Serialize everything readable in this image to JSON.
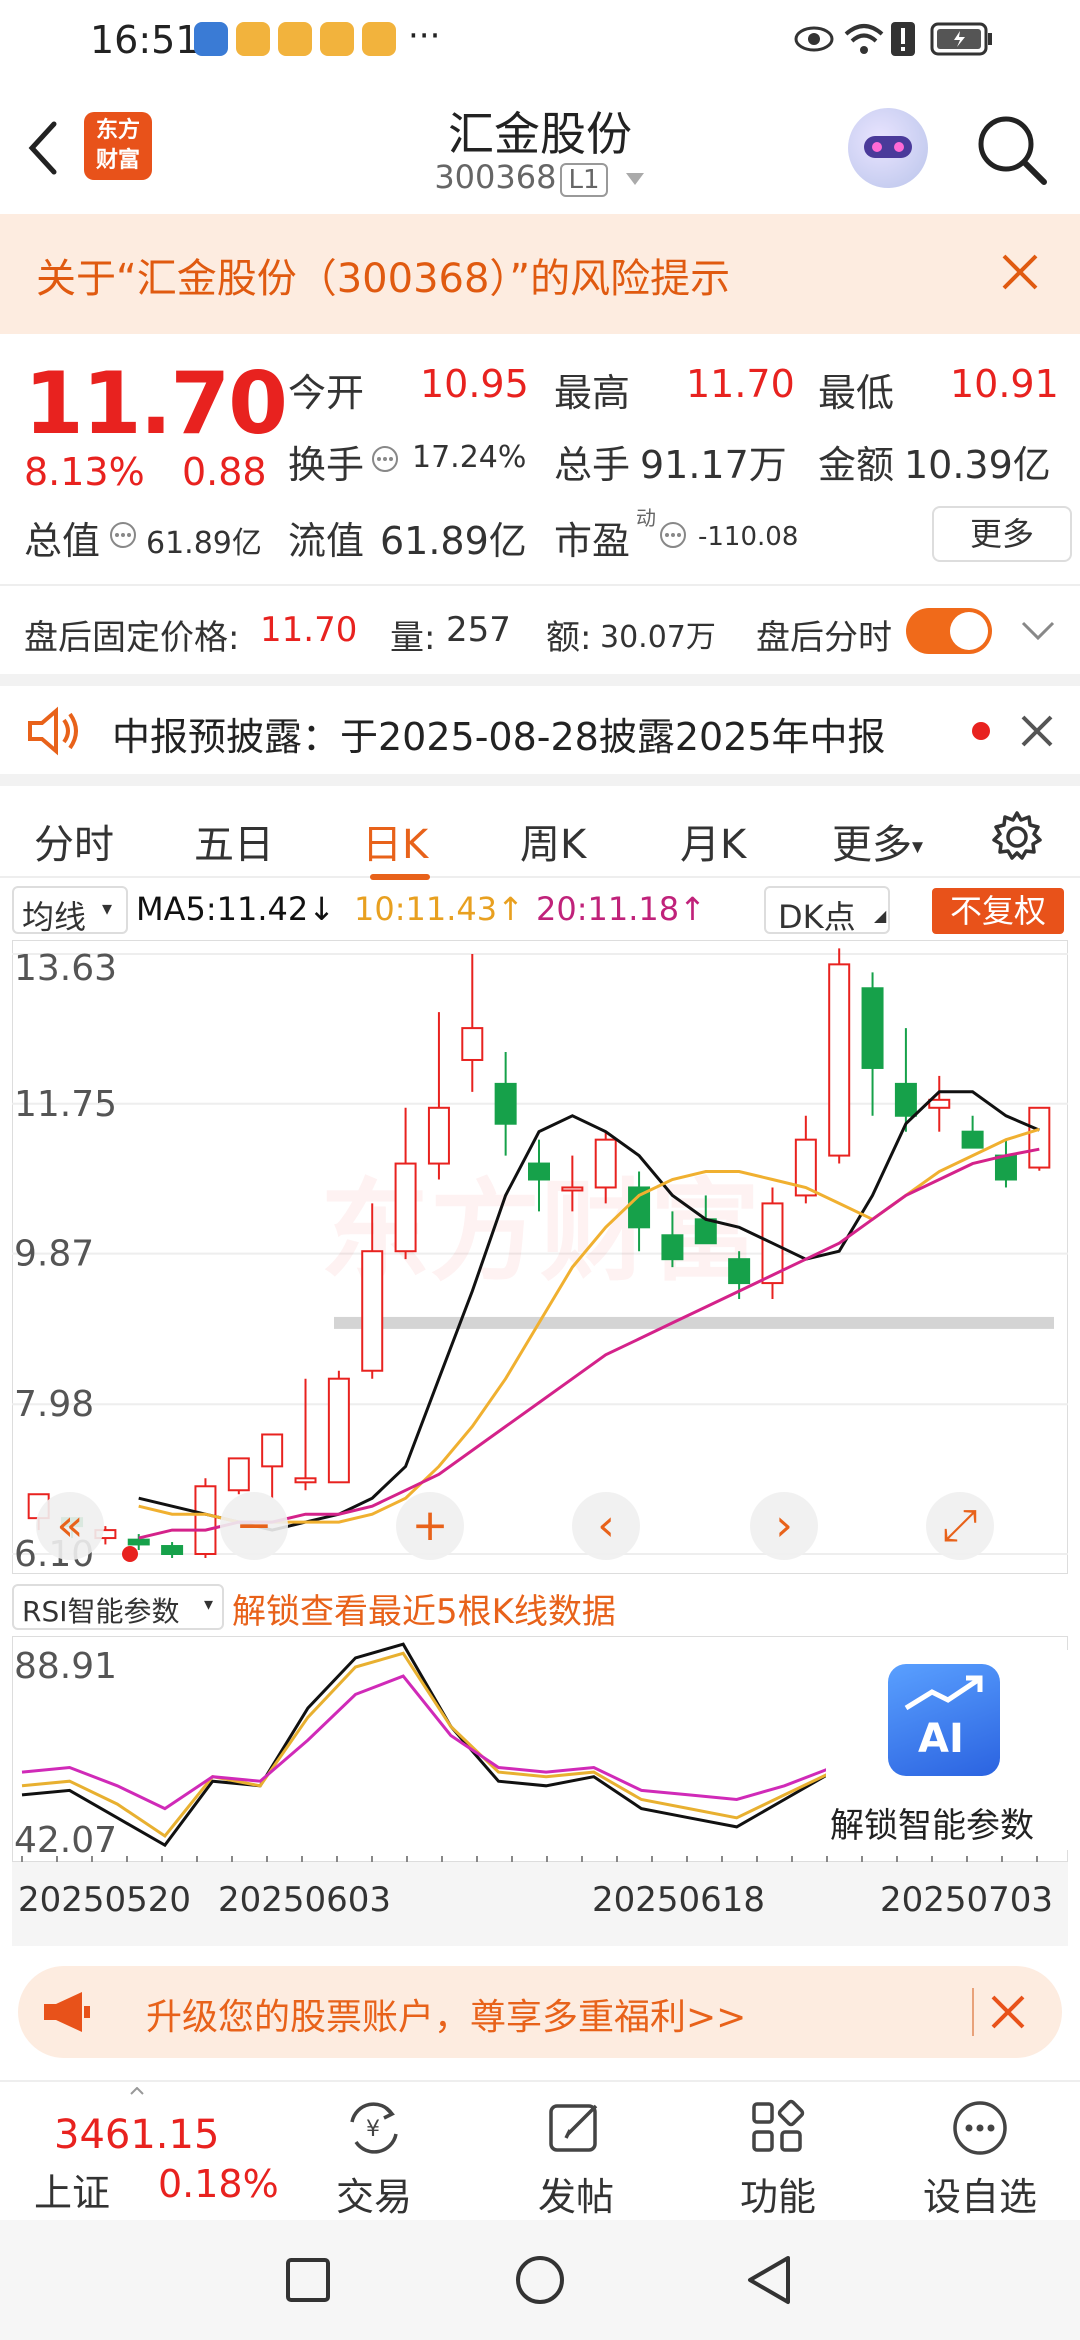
{
  "status_bar": {
    "time": "16:51",
    "dots": "···"
  },
  "header": {
    "title": "汇金股份",
    "code": "300368",
    "level": "L1",
    "logo_line1": "东方",
    "logo_line2": "财富"
  },
  "risk_banner": {
    "text": "关于“汇金股份（300368）”的风险提示"
  },
  "quote": {
    "price": "11.70",
    "change_pct": "8.13%",
    "change": "0.88",
    "open_label": "今开",
    "open": "10.95",
    "high_label": "最高",
    "high": "11.70",
    "low_label": "最低",
    "low": "10.91",
    "turnover_label": "换手",
    "turnover": "17.24%",
    "volume_label": "总手",
    "volume": "91.17万",
    "amount_label": "金额",
    "amount": "10.39亿",
    "mktcap_label": "总值",
    "mktcap": "61.89亿",
    "float_label": "流值",
    "float_cap": "61.89亿",
    "pe_label": "市盈",
    "pe_sup": "动",
    "pe": "-110.08",
    "more": "更多"
  },
  "after_hours": {
    "price_label": "盘后固定价格:",
    "price": "11.70",
    "vol_label": "量:",
    "vol": "257",
    "amt_label": "额:",
    "amt": "30.07万",
    "intraday_label": "盘后分时"
  },
  "notice": {
    "text": "中报预披露：于2025-08-28披露2025年中报"
  },
  "tabs": [
    "分时",
    "五日",
    "日K",
    "周K",
    "月K",
    "更多"
  ],
  "active_tab": 2,
  "ma_row": {
    "selector": "均线",
    "ma5": "MA5:11.42↓",
    "ma10": "10:11.43↑",
    "ma20": "20:11.18↑",
    "dk": "DK点",
    "adjust": "不复权"
  },
  "colors": {
    "up": "#e8221f",
    "down": "#16a14a",
    "accent": "#e8621a",
    "ma5": "#111111",
    "ma10": "#f0b030",
    "ma20": "#d4228a"
  },
  "chart_data": [
    {
      "type": "candlestick",
      "y_ticks": [
        "13.63",
        "11.75",
        "9.87",
        "7.98",
        "6.10"
      ],
      "ylim": [
        6.1,
        13.63
      ],
      "series": [
        {
          "name": "MA5",
          "values": [
            6.8,
            6.7,
            6.6,
            6.5,
            6.4,
            6.5,
            6.6,
            6.8,
            7.2,
            8.3,
            9.4,
            10.6,
            11.4,
            11.6,
            11.4,
            11.1,
            10.6,
            10.3,
            10.2,
            10.0,
            9.8,
            9.9,
            10.6,
            11.5,
            11.9,
            11.9,
            11.6,
            11.42
          ]
        },
        {
          "name": "10",
          "values": [
            6.7,
            6.6,
            6.6,
            6.5,
            6.5,
            6.5,
            6.5,
            6.6,
            6.8,
            7.2,
            7.7,
            8.3,
            9.0,
            9.7,
            10.2,
            10.6,
            10.8,
            10.9,
            10.9,
            10.8,
            10.7,
            10.5,
            10.3,
            10.6,
            10.9,
            11.1,
            11.3,
            11.43
          ]
        },
        {
          "name": "20",
          "values": [
            6.3,
            6.4,
            6.4,
            6.5,
            6.5,
            6.6,
            6.6,
            6.7,
            6.9,
            7.1,
            7.4,
            7.7,
            8.0,
            8.3,
            8.6,
            8.8,
            9.0,
            9.2,
            9.4,
            9.6,
            9.8,
            10.0,
            10.3,
            10.6,
            10.8,
            11.0,
            11.1,
            11.18
          ]
        }
      ],
      "candles": [
        {
          "o": 6.55,
          "h": 6.85,
          "l": 6.4,
          "c": 6.85
        },
        {
          "o": 6.55,
          "h": 6.55,
          "l": 6.3,
          "c": 6.45
        },
        {
          "o": 6.3,
          "h": 6.45,
          "l": 6.22,
          "c": 6.4
        },
        {
          "o": 6.28,
          "h": 6.35,
          "l": 6.15,
          "c": 6.22
        },
        {
          "o": 6.2,
          "h": 6.25,
          "l": 6.05,
          "c": 6.1
        },
        {
          "o": 6.1,
          "h": 7.05,
          "l": 6.05,
          "c": 6.95
        },
        {
          "o": 6.9,
          "h": 7.3,
          "l": 6.85,
          "c": 7.3
        },
        {
          "o": 7.2,
          "h": 7.6,
          "l": 6.8,
          "c": 7.6
        },
        {
          "o": 7.0,
          "h": 8.3,
          "l": 6.9,
          "c": 7.05
        },
        {
          "o": 7.0,
          "h": 8.4,
          "l": 7.0,
          "c": 8.3
        },
        {
          "o": 8.4,
          "h": 10.5,
          "l": 8.3,
          "c": 9.9
        },
        {
          "o": 9.9,
          "h": 11.7,
          "l": 9.8,
          "c": 11.0
        },
        {
          "o": 11.0,
          "h": 12.9,
          "l": 10.8,
          "c": 11.7
        },
        {
          "o": 12.3,
          "h": 13.63,
          "l": 11.9,
          "c": 12.7
        },
        {
          "o": 12.0,
          "h": 12.4,
          "l": 11.1,
          "c": 11.5
        },
        {
          "o": 11.0,
          "h": 11.3,
          "l": 10.4,
          "c": 10.8
        },
        {
          "o": 10.7,
          "h": 11.1,
          "l": 10.4,
          "c": 10.7
        },
        {
          "o": 10.7,
          "h": 11.4,
          "l": 10.5,
          "c": 11.3
        },
        {
          "o": 10.7,
          "h": 10.9,
          "l": 9.9,
          "c": 10.2
        },
        {
          "o": 10.1,
          "h": 10.4,
          "l": 9.7,
          "c": 9.8
        },
        {
          "o": 10.3,
          "h": 10.6,
          "l": 10.1,
          "c": 10.0
        },
        {
          "o": 9.8,
          "h": 9.9,
          "l": 9.3,
          "c": 9.5
        },
        {
          "o": 9.5,
          "h": 10.7,
          "l": 9.3,
          "c": 10.5
        },
        {
          "o": 10.6,
          "h": 11.6,
          "l": 10.5,
          "c": 11.3
        },
        {
          "o": 11.1,
          "h": 13.7,
          "l": 11.0,
          "c": 13.5
        },
        {
          "o": 13.2,
          "h": 13.4,
          "l": 11.6,
          "c": 12.2
        },
        {
          "o": 12.0,
          "h": 12.7,
          "l": 11.4,
          "c": 11.6
        },
        {
          "o": 11.7,
          "h": 12.1,
          "l": 11.4,
          "c": 11.8
        },
        {
          "o": 11.4,
          "h": 11.6,
          "l": 11.2,
          "c": 11.2
        },
        {
          "o": 11.1,
          "h": 11.3,
          "l": 10.7,
          "c": 10.8
        },
        {
          "o": 10.95,
          "h": 11.7,
          "l": 10.91,
          "c": 11.7
        }
      ]
    },
    {
      "type": "line",
      "title": "RSI智能参数",
      "unlock_text": "解锁查看最近5根K线数据",
      "y_ticks": [
        "88.91",
        "42.07"
      ],
      "ylim": [
        42.07,
        88.91
      ],
      "series": [
        {
          "name": "RSI1",
          "values": [
            55,
            56,
            50,
            44,
            58,
            57,
            74,
            85,
            88,
            70,
            58,
            57,
            59,
            52,
            50,
            48,
            54,
            60
          ]
        },
        {
          "name": "RSI2",
          "values": [
            57,
            58,
            53,
            46,
            59,
            57,
            72,
            83,
            86,
            70,
            60,
            59,
            60,
            54,
            52,
            50,
            55,
            60
          ]
        },
        {
          "name": "RSI3",
          "values": [
            60,
            61,
            57,
            52,
            59,
            58,
            67,
            77,
            81,
            68,
            61,
            60,
            61,
            56,
            55,
            54,
            57,
            61
          ]
        }
      ]
    }
  ],
  "dates": [
    "20250520",
    "20250603",
    "20250618",
    "20250703"
  ],
  "ai_panel": {
    "label": "解锁智能参数",
    "badge": "AI"
  },
  "promo": {
    "text": "升级您的股票账户，尊享多重福利>>"
  },
  "bottom_nav": {
    "index_value": "3461.15",
    "index_name": "上证",
    "index_pct": "0.18%",
    "items": [
      "交易",
      "发帖",
      "功能",
      "设自选"
    ]
  },
  "watermark": "东方财富"
}
